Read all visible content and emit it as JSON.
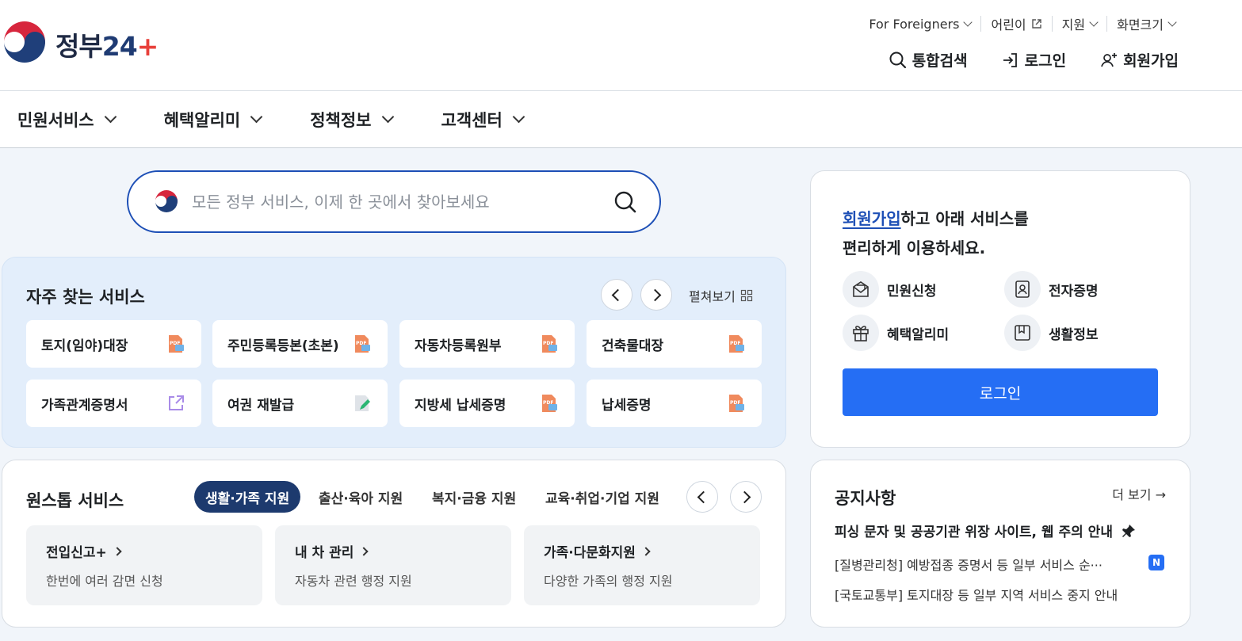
{
  "header": {
    "logo_text_main": "정부",
    "logo_text_num": "24",
    "util_links": [
      {
        "label": "For Foreigners"
      },
      {
        "label": "어린이"
      },
      {
        "label": "지원"
      },
      {
        "label": "화면크기"
      }
    ],
    "actions": {
      "search": "통합검색",
      "login": "로그인",
      "signup": "회원가입"
    }
  },
  "nav": {
    "items": [
      {
        "label": "민원서비스"
      },
      {
        "label": "혜택알리미"
      },
      {
        "label": "정책정보"
      },
      {
        "label": "고객센터"
      }
    ]
  },
  "search": {
    "placeholder": "모든 정부 서비스, 이제 한 곳에서 찾아보세요"
  },
  "frequent": {
    "title": "자주 찾는 서비스",
    "expand_label": "펼쳐보기",
    "items": [
      {
        "label": "토지(임야)대장",
        "icon": "pdf-doc-icon"
      },
      {
        "label": "주민등록등본(초본)",
        "icon": "pdf-doc-icon"
      },
      {
        "label": "자동차등록원부",
        "icon": "pdf-doc-icon"
      },
      {
        "label": "건축물대장",
        "icon": "pdf-doc-icon"
      },
      {
        "label": "가족관계증명서",
        "icon": "external-link-icon"
      },
      {
        "label": "여권 재발급",
        "icon": "edit-doc-icon"
      },
      {
        "label": "지방세 납세증명",
        "icon": "pdf-doc-icon"
      },
      {
        "label": "납세증명",
        "icon": "pdf-doc-icon"
      }
    ]
  },
  "onestop": {
    "title": "원스톱 서비스",
    "tabs": [
      {
        "label": "생활·가족 지원",
        "active": true
      },
      {
        "label": "출산·육아 지원",
        "active": false
      },
      {
        "label": "복지·금융 지원",
        "active": false
      },
      {
        "label": "교육·취업·기업 지원",
        "active": false
      }
    ],
    "cards": [
      {
        "title": "전입신고+",
        "desc": "한번에 여러 감면 신청"
      },
      {
        "title": "내 차 관리",
        "desc": "자동차 관련 행정 지원"
      },
      {
        "title": "가족·다문화지원",
        "desc": "다양한 가족의 행정 지원"
      }
    ]
  },
  "loginbox": {
    "msg_highlight": "회원가입",
    "msg_line1_rest": "하고 아래 서비스를",
    "msg_line2": "편리하게 이용하세요.",
    "services": [
      {
        "label": "민원신청",
        "icon": "mail-doc-icon"
      },
      {
        "label": "전자증명",
        "icon": "id-card-icon"
      },
      {
        "label": "혜택알리미",
        "icon": "gift-icon"
      },
      {
        "label": "생활정보",
        "icon": "bookmark-icon"
      }
    ],
    "login_button": "로그인",
    "accent": "#256ef4"
  },
  "notice": {
    "title": "공지사항",
    "more": "더 보기 →",
    "items": [
      {
        "text": "피싱 문자 및 공공기관 위장 사이트, 웹 주의 안내",
        "pinned": true
      },
      {
        "text": "[질병관리청] 예방접종 증명서 등 일부 서비스 순···",
        "badge": "N"
      },
      {
        "text": "[국토교통부] 토지대장 등 일부 지역 서비스 중지 안내"
      }
    ]
  }
}
